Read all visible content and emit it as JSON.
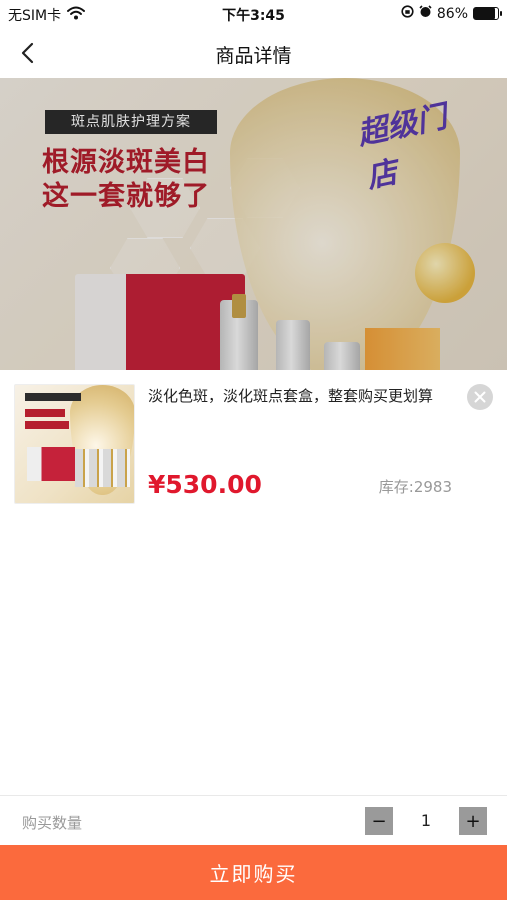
{
  "status_bar": {
    "carrier": "无SIM卡",
    "time": "下午3:45",
    "battery_percent": "86%",
    "battery_level": 0.86,
    "icons": [
      "wifi-icon",
      "orientation-lock-icon",
      "alarm-icon",
      "battery-icon"
    ]
  },
  "nav": {
    "title": "商品详情",
    "back_icon": "chevron-left-icon"
  },
  "banner": {
    "tag": "斑点肌肤护理方案",
    "headline_line1": "根源淡斑美白",
    "headline_line2": "这一套就够了",
    "stamp_text": "超级门店"
  },
  "product": {
    "title": "淡化色斑，淡化斑点套盒，整套购买更划算",
    "price": "¥530.00",
    "stock_label": "库存:",
    "stock_value": "2983",
    "close_icon": "close-icon"
  },
  "quantity": {
    "label": "购买数量",
    "minus": "−",
    "value": "1",
    "plus": "+"
  },
  "actions": {
    "buy_label": "立即购买"
  },
  "colors": {
    "accent": "#fb6a3d",
    "price": "#e0182d",
    "headline": "#b51f2e"
  }
}
